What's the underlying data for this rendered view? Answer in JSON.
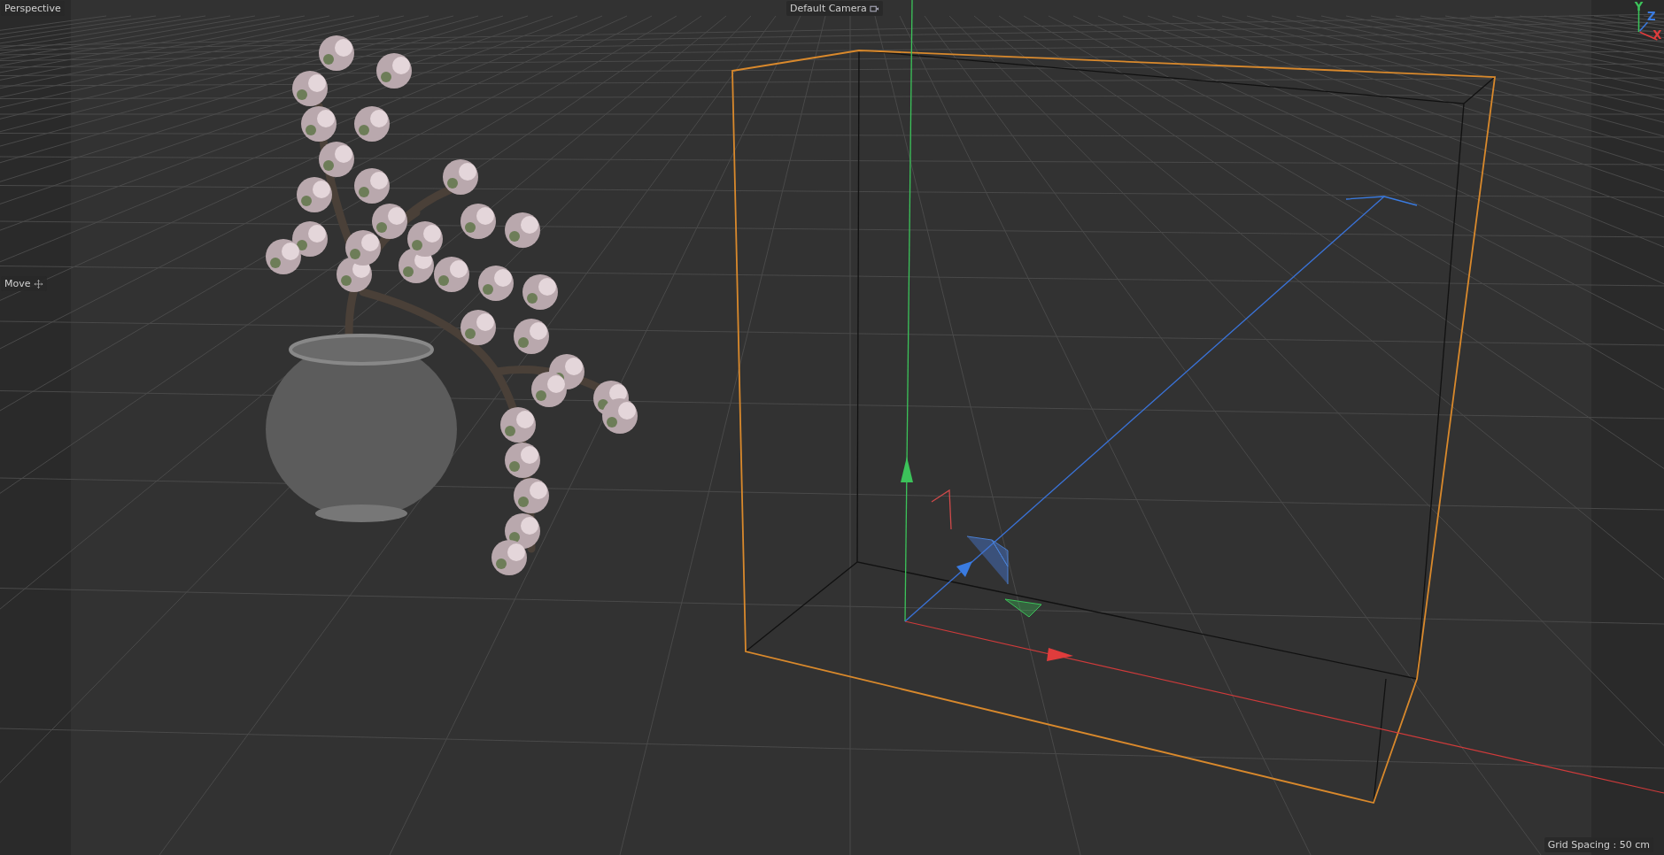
{
  "viewport": {
    "view_name": "Perspective",
    "camera": "Default Camera",
    "tool": "Move",
    "grid_spacing": "Grid Spacing : 50 cm"
  },
  "axis_gizmo": [
    {
      "label": "Y",
      "color": "#3cc35a"
    },
    {
      "label": "Z",
      "color": "#3a7be0"
    },
    {
      "label": "X",
      "color": "#e03c3c"
    }
  ]
}
